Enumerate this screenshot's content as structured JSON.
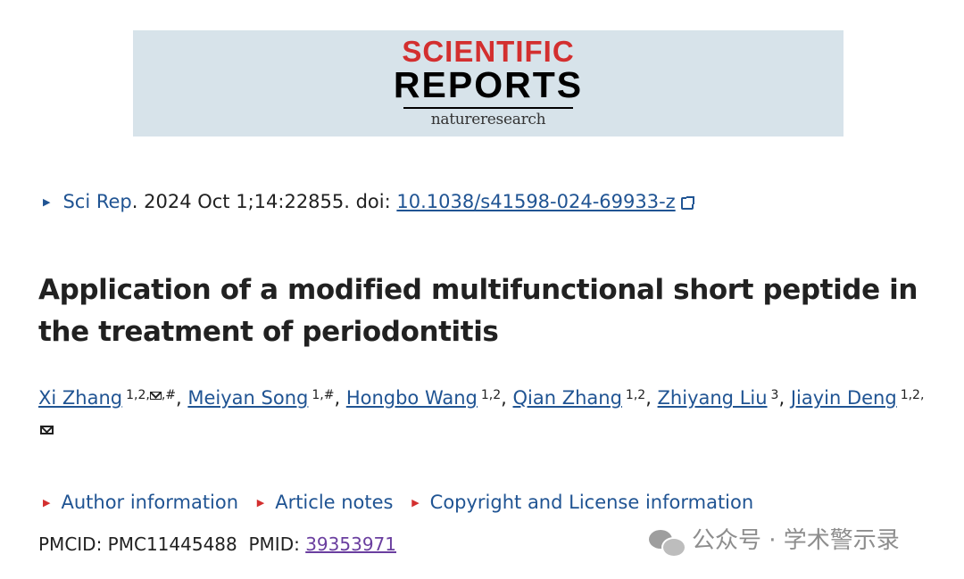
{
  "banner": {
    "line1": "SCIENTIFIC",
    "line2": "REPORTS",
    "line3": "natureresearch",
    "bg_color": "#d7e3ea",
    "accent_color": "#d32f2f"
  },
  "citation": {
    "journal_link": "Sci Rep",
    "text": ". 2024 Oct 1;14:22855. doi: ",
    "doi_link": "10.1038/s41598-024-69933-z"
  },
  "article": {
    "title": "Application of a modified multifunctional short peptide in the treatment of periodontitis"
  },
  "authors": [
    {
      "name": "Xi Zhang",
      "aff_pre": "1,2,",
      "aff_post": ",#"
    },
    {
      "name": "Meiyan Song",
      "aff": "1,#"
    },
    {
      "name": "Hongbo Wang",
      "aff": "1,2"
    },
    {
      "name": "Qian Zhang",
      "aff": "1,2"
    },
    {
      "name": "Zhiyang Liu",
      "aff": "3"
    },
    {
      "name": "Jiayin Deng",
      "aff": "1,2,"
    }
  ],
  "info_links": [
    "Author information",
    "Article notes",
    "Copyright and License information"
  ],
  "ids": {
    "pmcid_label": "PMCID: PMC11445488",
    "pmid_label": "PMID: ",
    "pmid_value": "39353971"
  },
  "watermark": {
    "text": "公众号 · 学术警示录"
  }
}
